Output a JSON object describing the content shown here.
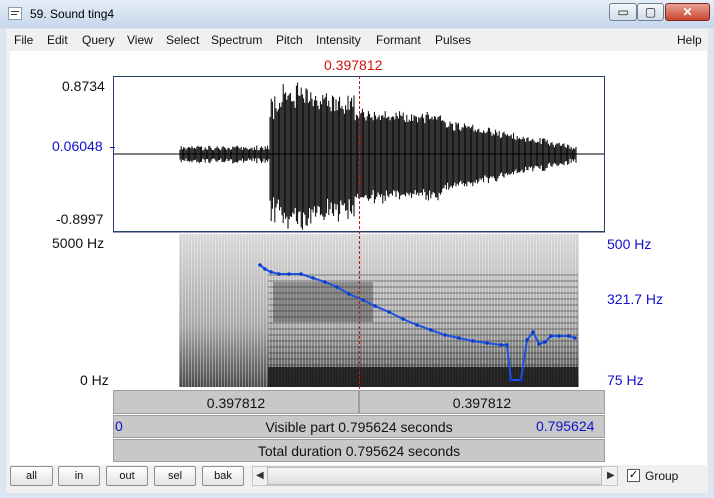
{
  "window": {
    "title": "59. Sound ting4",
    "controls": {
      "minimize_glyph": "▭",
      "maximize_glyph": "▢",
      "close_glyph": "✕"
    }
  },
  "menubar": {
    "left_items": [
      "File",
      "Edit",
      "Query",
      "View",
      "Select",
      "Spectrum",
      "Pitch",
      "Intensity",
      "Formant",
      "Pulses"
    ],
    "help": "Help"
  },
  "cursor": {
    "time": "0.397812"
  },
  "waveform": {
    "max": "0.8734",
    "mid": "0.06048",
    "min": "-0.8997"
  },
  "spectrogram": {
    "freq_top": "5000 Hz",
    "freq_bottom": "0 Hz"
  },
  "pitch_axis": {
    "top": "500 Hz",
    "mid": "321.7 Hz",
    "bottom": "75 Hz"
  },
  "time_bars": {
    "left_segment": "0.397812",
    "right_segment": "0.397812",
    "visible_start": "0",
    "visible_label": "Visible part 0.795624 seconds",
    "visible_end": "0.795624",
    "total_label": "Total duration 0.795624 seconds"
  },
  "buttons": {
    "all": "all",
    "in": "in",
    "out": "out",
    "sel": "sel",
    "bak": "bak"
  },
  "group": {
    "label": "Group",
    "checked": true,
    "check_glyph": "✓"
  },
  "colors": {
    "label_blue": "#1010c8",
    "cursor_red": "#d11010",
    "pitch_blue": "#1f52e0"
  }
}
